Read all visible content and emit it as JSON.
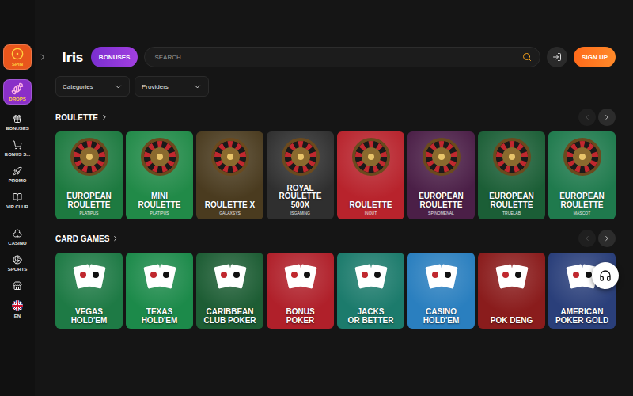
{
  "sidebar": {
    "featured": [
      {
        "label": "SPIN",
        "color": "#e8561c"
      },
      {
        "label": "DROPS",
        "color": "#8a2fc8"
      }
    ],
    "items": [
      {
        "label": "BONUSES"
      },
      {
        "label": "BONUS S..."
      },
      {
        "label": "PROMO"
      },
      {
        "label": "VIP CLUB"
      },
      {
        "label": "CASINO"
      },
      {
        "label": "SPORTS"
      }
    ],
    "language": "EN"
  },
  "header": {
    "logo": "Iris",
    "bonuses_button": "BONUSES",
    "search": {
      "placeholder": "SEARCH"
    },
    "signup_button": "SIGN UP"
  },
  "filters": [
    {
      "label": "Categories"
    },
    {
      "label": "Providers"
    }
  ],
  "sections": [
    {
      "title": "ROULETTE",
      "kind": "roulette",
      "prev_disabled": true,
      "next_disabled": false,
      "games": [
        {
          "lines": [
            "EUROPEAN",
            "ROULETTE"
          ],
          "provider": "PLATIPUS",
          "color": "#1d7a40"
        },
        {
          "lines": [
            "MINI",
            "ROULETTE"
          ],
          "provider": "PLATIPUS",
          "color": "#218a48"
        },
        {
          "lines": [
            "ROULETTE X"
          ],
          "provider": "GALAXSYS",
          "color": "#4a3b1f"
        },
        {
          "lines": [
            "ROYAL",
            "ROULETTE",
            "500X"
          ],
          "provider": "ISGAMING",
          "color": "#2f2f2f"
        },
        {
          "lines": [
            "ROULETTE"
          ],
          "provider": "INOUT",
          "color": "#b8232c"
        },
        {
          "lines": [
            "EUROPEAN",
            "ROULETTE"
          ],
          "provider": "SPINOMENAL",
          "color": "#4b1f47"
        },
        {
          "lines": [
            "EUROPEAN",
            "ROULETTE"
          ],
          "provider": "TRUELAB",
          "color": "#1b5e36"
        },
        {
          "lines": [
            "EUROPEAN",
            "ROULETTE"
          ],
          "provider": "MASCOT",
          "color": "#1f7a4d"
        }
      ]
    },
    {
      "title": "CARD GAMES",
      "kind": "cards",
      "prev_disabled": true,
      "next_disabled": false,
      "games": [
        {
          "lines": [
            "VEGAS",
            "HOLD'EM"
          ],
          "provider": "",
          "color": "#1e7a45"
        },
        {
          "lines": [
            "TEXAS",
            "HOLD'EM"
          ],
          "provider": "",
          "color": "#1c8a4a"
        },
        {
          "lines": [
            "CARIBBEAN",
            "CLUB POKER"
          ],
          "provider": "",
          "color": "#1d5d34"
        },
        {
          "lines": [
            "BONUS",
            "POKER"
          ],
          "provider": "",
          "color": "#b0202a"
        },
        {
          "lines": [
            "JACKS",
            "OR BETTER"
          ],
          "provider": "",
          "color": "#1c7b6c"
        },
        {
          "lines": [
            "CASINO",
            "HOLD'EM"
          ],
          "provider": "",
          "color": "#2a7fbf"
        },
        {
          "lines": [
            "POK DENG"
          ],
          "provider": "",
          "color": "#8a1c1c"
        },
        {
          "lines": [
            "AMERICAN",
            "POKER GOLD"
          ],
          "provider": "",
          "color": "#2a3f7a"
        }
      ]
    }
  ]
}
